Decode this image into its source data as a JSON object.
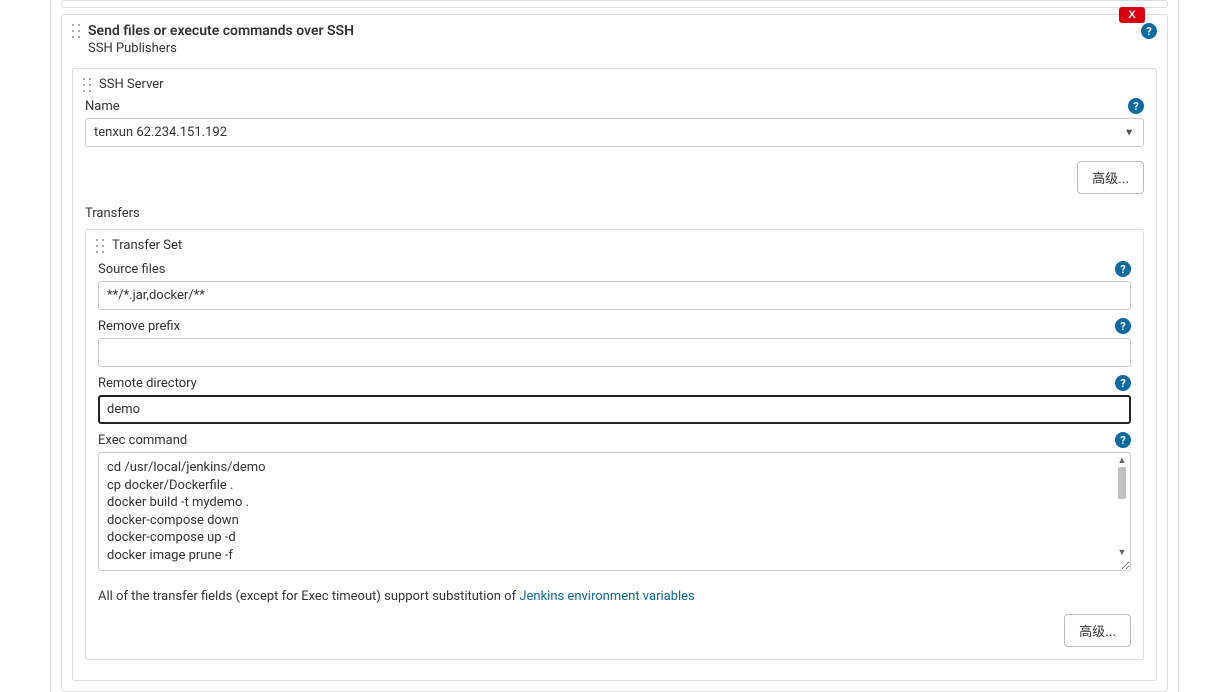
{
  "section": {
    "title": "Send files or execute commands over SSH",
    "subtitle": "SSH Publishers",
    "delete_label": "X"
  },
  "sshServer": {
    "block_title": "SSH Server",
    "name_label": "Name",
    "name_value": "tenxun 62.234.151.192",
    "advanced_label": "高级..."
  },
  "transfers": {
    "label": "Transfers",
    "set_title": "Transfer Set",
    "source_files_label": "Source files",
    "source_files_value": "**/*.jar,docker/**",
    "remove_prefix_label": "Remove prefix",
    "remove_prefix_value": "",
    "remote_dir_label": "Remote directory",
    "remote_dir_value": "demo",
    "exec_label": "Exec command",
    "exec_value": "cd /usr/local/jenkins/demo\ncp docker/Dockerfile .\ndocker build -t mydemo .\ndocker-compose down\ndocker-compose up -d\ndocker image prune -f",
    "note_pre": "All of the transfer fields (except for Exec timeout) support substitution of ",
    "note_link": "Jenkins environment variables",
    "advanced_label": "高级..."
  },
  "help_glyph": "?"
}
